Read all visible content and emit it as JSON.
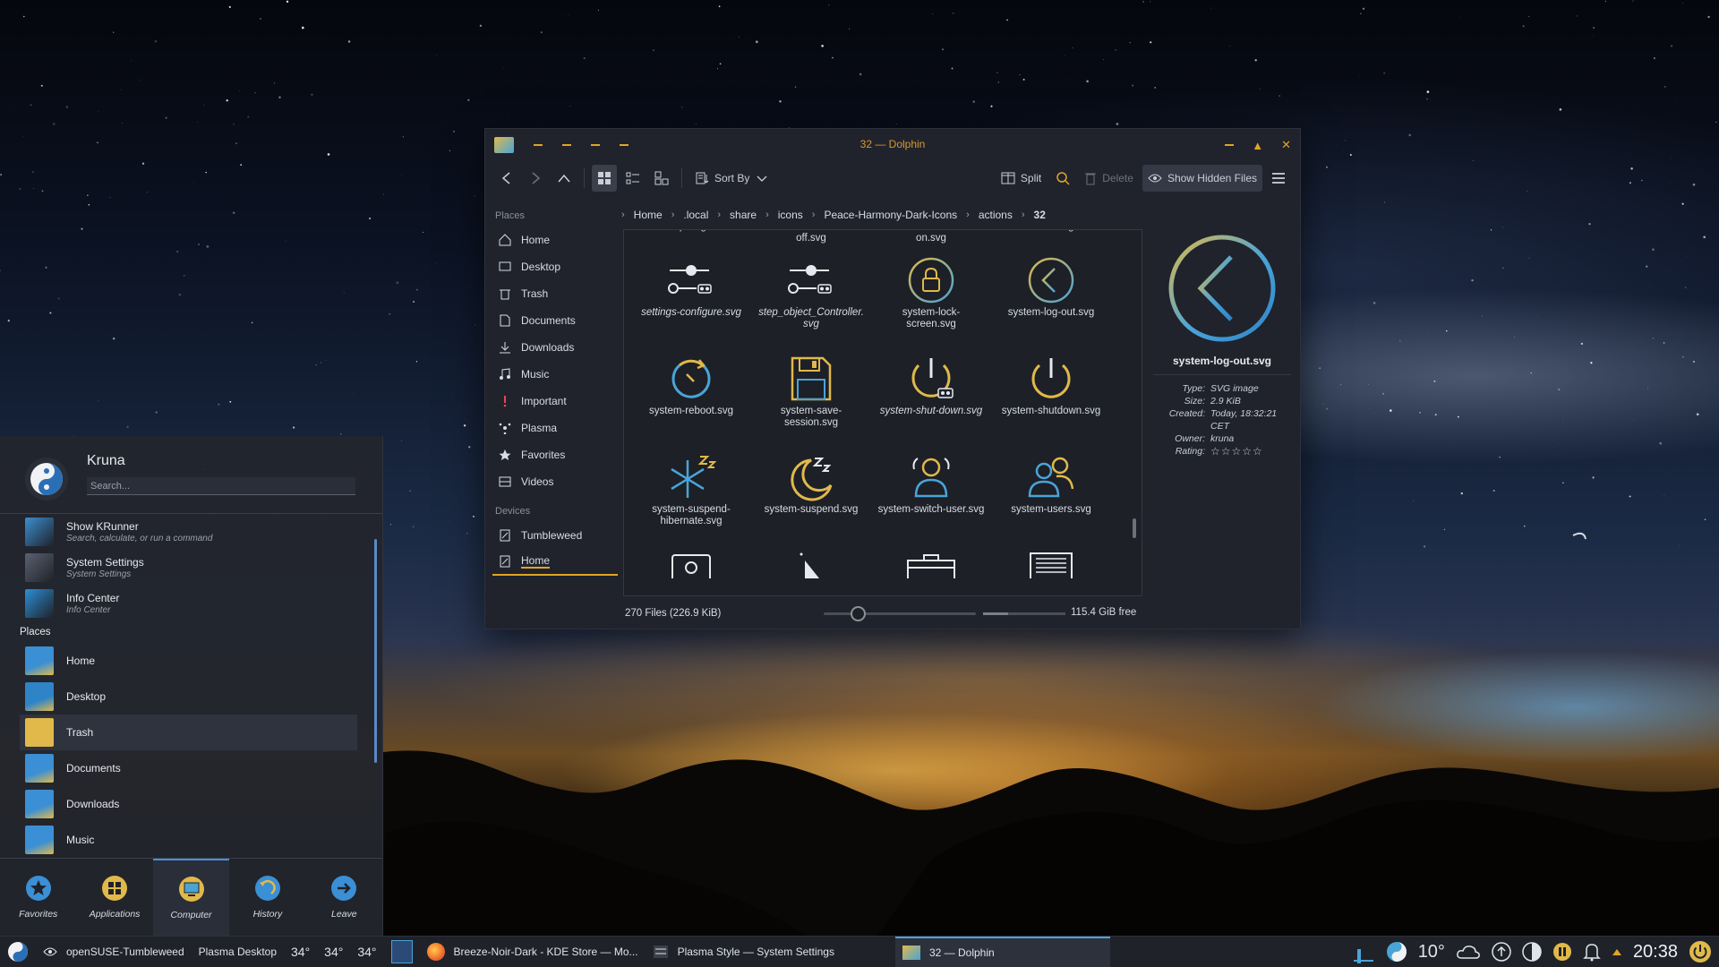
{
  "dolphin": {
    "title": "32 — Dolphin",
    "toolbar": {
      "sort_label": "Sort By",
      "split_label": "Split",
      "delete_label": "Delete",
      "hidden_label": "Show Hidden Files"
    },
    "places_header": "Places",
    "places": [
      "Home",
      "Desktop",
      "Trash",
      "Documents",
      "Downloads",
      "Music",
      "Important",
      "Plasma",
      "Favorites",
      "Videos"
    ],
    "devices_header": "Devices",
    "devices": [
      "Tumbleweed",
      "Home"
    ],
    "breadcrumb": [
      "Home",
      ".local",
      "share",
      "icons",
      "Peace-Harmony-Dark-Icons",
      "actions",
      "32"
    ],
    "top_captions": [
      "qa.svg",
      "screen-rotate-auto-off.svg",
      "screen-rotate-auto-on.svg",
      "select.svg"
    ],
    "files": [
      [
        {
          "name": "settings-configure.svg",
          "italic": true,
          "icon": "settings-icon"
        },
        {
          "name": "step_object_Controller.svg",
          "italic": true,
          "icon": "controller-icon"
        },
        {
          "name": "system-lock-screen.svg",
          "italic": false,
          "icon": "lock-icon"
        },
        {
          "name": "system-log-out.svg",
          "italic": false,
          "icon": "logout-icon"
        }
      ],
      [
        {
          "name": "system-reboot.svg",
          "italic": false,
          "icon": "reboot-icon"
        },
        {
          "name": "system-save-session.svg",
          "italic": false,
          "icon": "save-icon"
        },
        {
          "name": "system-shut-down.svg",
          "italic": true,
          "icon": "power-link-icon"
        },
        {
          "name": "system-shutdown.svg",
          "italic": false,
          "icon": "power-icon"
        }
      ],
      [
        {
          "name": "system-suspend-hibernate.svg",
          "italic": false,
          "icon": "snowflake-icon"
        },
        {
          "name": "system-suspend.svg",
          "italic": false,
          "icon": "moon-icon"
        },
        {
          "name": "system-switch-user.svg",
          "italic": false,
          "icon": "switch-user-icon"
        },
        {
          "name": "system-users.svg",
          "italic": false,
          "icon": "users-icon"
        }
      ]
    ],
    "info": {
      "name": "system-log-out.svg",
      "rows": [
        {
          "k": "Type:",
          "v": "SVG image"
        },
        {
          "k": "Size:",
          "v": "2.9 KiB"
        },
        {
          "k": "Created:",
          "v": "Today, 18:32:21 CET"
        },
        {
          "k": "Owner:",
          "v": "kruna"
        },
        {
          "k": "Rating:",
          "v": "☆☆☆☆☆"
        }
      ]
    },
    "status": {
      "count": "270 Files (226.9 KiB)",
      "free": "115.4 GiB free",
      "zoom_fraction": 0.2,
      "used_fraction": 0.3
    }
  },
  "kickoff": {
    "user": "Kruna",
    "search_placeholder": "Search...",
    "apps": [
      {
        "title": "Show KRunner",
        "sub": "Search, calculate, or run a command",
        "color": "#3c8fd0"
      },
      {
        "title": "System Settings",
        "sub": "System Settings",
        "color": "#5a6170"
      },
      {
        "title": "Info Center",
        "sub": "Info Center",
        "color": "#2b8fd6"
      }
    ],
    "places_header": "Places",
    "places": [
      {
        "title": "Home",
        "color": "#3b8fd4"
      },
      {
        "title": "Desktop",
        "color": "#2f84c8"
      },
      {
        "title": "Trash",
        "color": "#e0b94a"
      },
      {
        "title": "Documents",
        "color": "#3b8fd4"
      },
      {
        "title": "Downloads",
        "color": "#3b8fd4"
      },
      {
        "title": "Music",
        "color": "#3b8fd4"
      }
    ],
    "tabs": [
      "Favorites",
      "Applications",
      "Computer",
      "History",
      "Leave"
    ]
  },
  "taskbar": {
    "items": [
      "openSUSE-Tumbleweed",
      "Plasma Desktop"
    ],
    "temps": [
      "34°",
      "34°",
      "34°"
    ],
    "windows": [
      "Breeze-Noir-Dark - KDE Store — Mo...",
      "Plasma Style — System Settings",
      "32 — Dolphin"
    ],
    "weather": "10°",
    "clock": "20:38"
  }
}
